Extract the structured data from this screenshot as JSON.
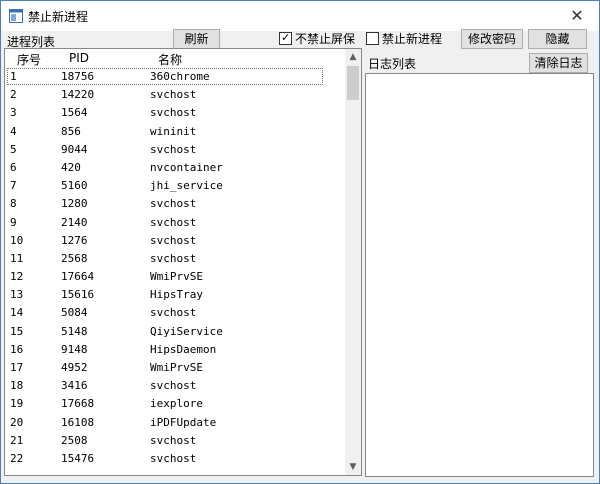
{
  "window": {
    "title": "禁止新进程",
    "close_glyph": "✕"
  },
  "toolbar": {
    "process_list_label": "进程列表",
    "refresh_label": "刷新",
    "no_block_screensaver_label": "不禁止屏保",
    "no_block_screensaver_checked": true,
    "block_new_process_label": "禁止新进程",
    "block_new_process_checked": false,
    "change_password_label": "修改密码",
    "hide_label": "隐藏"
  },
  "log": {
    "label": "日志列表",
    "clear_label": "清除日志"
  },
  "table": {
    "columns": [
      "序号",
      "PID",
      "名称"
    ],
    "rows": [
      [
        "1",
        "18756",
        "360chrome"
      ],
      [
        "2",
        "14220",
        "svchost"
      ],
      [
        "3",
        "1564",
        "svchost"
      ],
      [
        "4",
        "856",
        "wininit"
      ],
      [
        "5",
        "9044",
        "svchost"
      ],
      [
        "6",
        "420",
        "nvcontainer"
      ],
      [
        "7",
        "5160",
        "jhi_service"
      ],
      [
        "8",
        "1280",
        "svchost"
      ],
      [
        "9",
        "2140",
        "svchost"
      ],
      [
        "10",
        "1276",
        "svchost"
      ],
      [
        "11",
        "2568",
        "svchost"
      ],
      [
        "12",
        "17664",
        "WmiPrvSE"
      ],
      [
        "13",
        "15616",
        "HipsTray"
      ],
      [
        "14",
        "5084",
        "svchost"
      ],
      [
        "15",
        "5148",
        "QiyiService"
      ],
      [
        "16",
        "9148",
        "HipsDaemon"
      ],
      [
        "17",
        "4952",
        "WmiPrvSE"
      ],
      [
        "18",
        "3416",
        "svchost"
      ],
      [
        "19",
        "17668",
        "iexplore"
      ],
      [
        "20",
        "16108",
        "iPDFUpdate"
      ],
      [
        "21",
        "2508",
        "svchost"
      ],
      [
        "22",
        "15476",
        "svchost"
      ]
    ]
  },
  "scroll": {
    "up_glyph": "▲",
    "down_glyph": "▼"
  },
  "colors": {
    "titlebar_bg": "#ffffff",
    "border": "#4a7fc1",
    "button_bg": "#e1e1e1"
  }
}
